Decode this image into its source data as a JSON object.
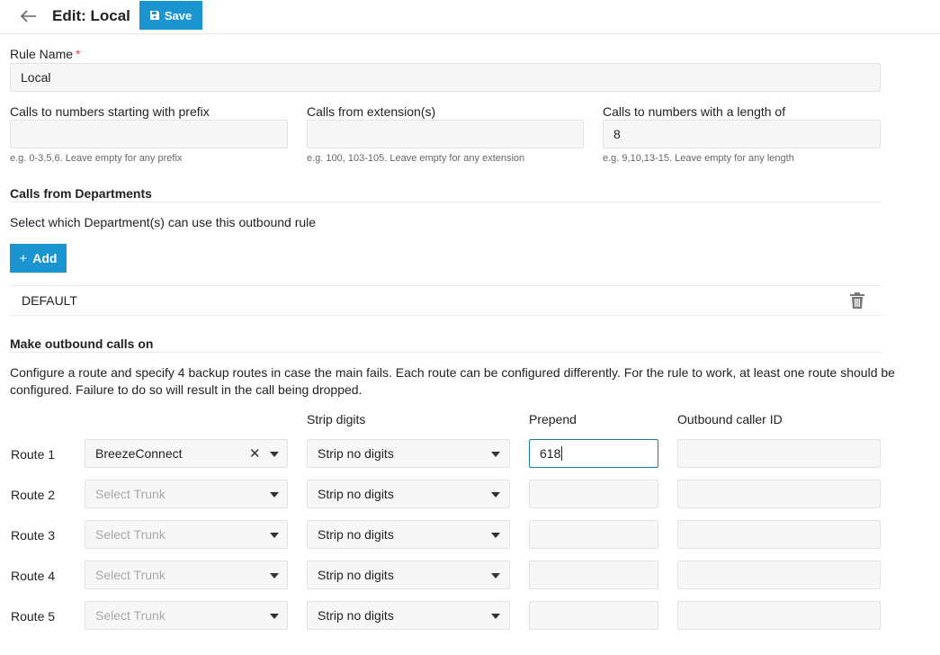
{
  "header": {
    "title": "Edit: Local",
    "save_label": "Save"
  },
  "rule_name": {
    "label": "Rule Name",
    "required_mark": "*",
    "value": "Local"
  },
  "prefix": {
    "label": "Calls to numbers starting with prefix",
    "value": "",
    "hint": "e.g. 0-3,5,6. Leave empty for any prefix"
  },
  "extensions": {
    "label": "Calls from extension(s)",
    "value": "",
    "hint": "e.g. 100, 103-105. Leave empty for any extension"
  },
  "length": {
    "label": "Calls to numbers with a length of",
    "value": "8",
    "hint": "e.g. 9,10,13-15. Leave empty for any length"
  },
  "departments": {
    "title": "Calls from Departments",
    "description": "Select which Department(s) can use this outbound rule",
    "add_label": "Add",
    "items": [
      {
        "name": "DEFAULT"
      }
    ]
  },
  "outbound": {
    "title": "Make outbound calls on",
    "description_line1": "Configure a route and specify 4 backup routes in case the main fails. Each route can be configured differently. For the rule to work, at least one route should be",
    "description_line2": "configured. Failure to do so will result in the call being dropped.",
    "columns": {
      "strip": "Strip digits",
      "prepend": "Prepend",
      "caller_id": "Outbound caller ID"
    },
    "trunk_placeholder": "Select Trunk",
    "routes": [
      {
        "label": "Route 1",
        "trunk": "BreezeConnect",
        "strip": "Strip no digits",
        "prepend": "618",
        "caller_id": ""
      },
      {
        "label": "Route 2",
        "trunk": "",
        "strip": "Strip no digits",
        "prepend": "",
        "caller_id": ""
      },
      {
        "label": "Route 3",
        "trunk": "",
        "strip": "Strip no digits",
        "prepend": "",
        "caller_id": ""
      },
      {
        "label": "Route 4",
        "trunk": "",
        "strip": "Strip no digits",
        "prepend": "",
        "caller_id": ""
      },
      {
        "label": "Route 5",
        "trunk": "",
        "strip": "Strip no digits",
        "prepend": "",
        "caller_id": ""
      }
    ]
  },
  "icons": {
    "back": "arrow-left-icon",
    "save": "floppy-disk-icon",
    "add": "plus-icon",
    "delete": "trash-icon",
    "clear": "close-icon",
    "dropdown": "caret-down-icon"
  },
  "colors": {
    "accent": "#1a95d0",
    "required": "#e04545",
    "focus_border": "#1a7aa6"
  }
}
